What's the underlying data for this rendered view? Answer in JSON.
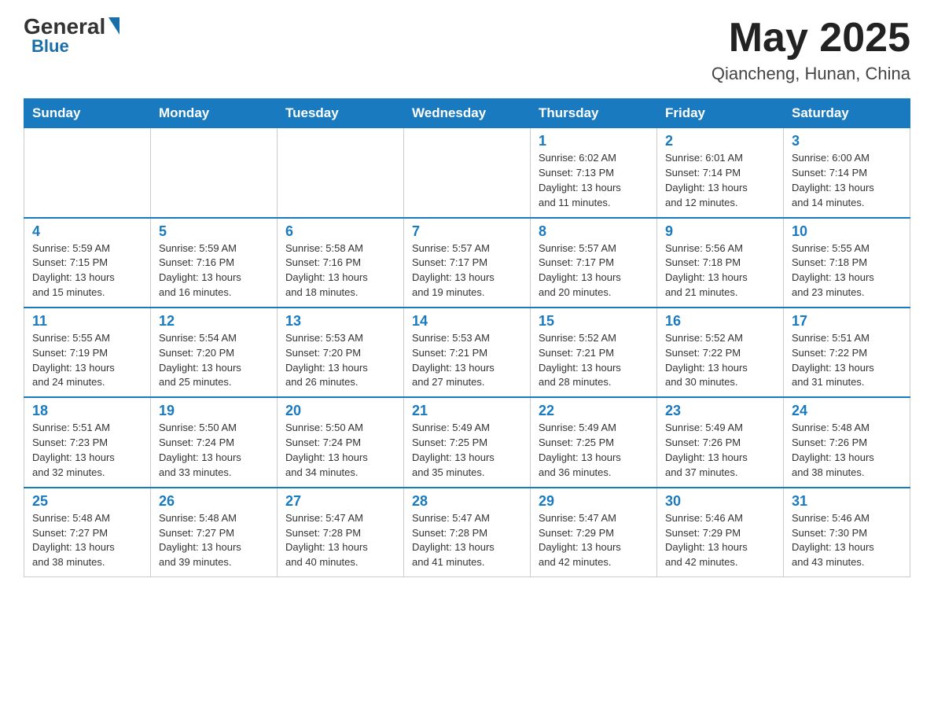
{
  "logo": {
    "general": "General",
    "blue": "Blue"
  },
  "title": {
    "month": "May 2025",
    "location": "Qiancheng, Hunan, China"
  },
  "weekdays": [
    "Sunday",
    "Monday",
    "Tuesday",
    "Wednesday",
    "Thursday",
    "Friday",
    "Saturday"
  ],
  "weeks": [
    [
      {
        "day": "",
        "info": ""
      },
      {
        "day": "",
        "info": ""
      },
      {
        "day": "",
        "info": ""
      },
      {
        "day": "",
        "info": ""
      },
      {
        "day": "1",
        "info": "Sunrise: 6:02 AM\nSunset: 7:13 PM\nDaylight: 13 hours\nand 11 minutes."
      },
      {
        "day": "2",
        "info": "Sunrise: 6:01 AM\nSunset: 7:14 PM\nDaylight: 13 hours\nand 12 minutes."
      },
      {
        "day": "3",
        "info": "Sunrise: 6:00 AM\nSunset: 7:14 PM\nDaylight: 13 hours\nand 14 minutes."
      }
    ],
    [
      {
        "day": "4",
        "info": "Sunrise: 5:59 AM\nSunset: 7:15 PM\nDaylight: 13 hours\nand 15 minutes."
      },
      {
        "day": "5",
        "info": "Sunrise: 5:59 AM\nSunset: 7:16 PM\nDaylight: 13 hours\nand 16 minutes."
      },
      {
        "day": "6",
        "info": "Sunrise: 5:58 AM\nSunset: 7:16 PM\nDaylight: 13 hours\nand 18 minutes."
      },
      {
        "day": "7",
        "info": "Sunrise: 5:57 AM\nSunset: 7:17 PM\nDaylight: 13 hours\nand 19 minutes."
      },
      {
        "day": "8",
        "info": "Sunrise: 5:57 AM\nSunset: 7:17 PM\nDaylight: 13 hours\nand 20 minutes."
      },
      {
        "day": "9",
        "info": "Sunrise: 5:56 AM\nSunset: 7:18 PM\nDaylight: 13 hours\nand 21 minutes."
      },
      {
        "day": "10",
        "info": "Sunrise: 5:55 AM\nSunset: 7:18 PM\nDaylight: 13 hours\nand 23 minutes."
      }
    ],
    [
      {
        "day": "11",
        "info": "Sunrise: 5:55 AM\nSunset: 7:19 PM\nDaylight: 13 hours\nand 24 minutes."
      },
      {
        "day": "12",
        "info": "Sunrise: 5:54 AM\nSunset: 7:20 PM\nDaylight: 13 hours\nand 25 minutes."
      },
      {
        "day": "13",
        "info": "Sunrise: 5:53 AM\nSunset: 7:20 PM\nDaylight: 13 hours\nand 26 minutes."
      },
      {
        "day": "14",
        "info": "Sunrise: 5:53 AM\nSunset: 7:21 PM\nDaylight: 13 hours\nand 27 minutes."
      },
      {
        "day": "15",
        "info": "Sunrise: 5:52 AM\nSunset: 7:21 PM\nDaylight: 13 hours\nand 28 minutes."
      },
      {
        "day": "16",
        "info": "Sunrise: 5:52 AM\nSunset: 7:22 PM\nDaylight: 13 hours\nand 30 minutes."
      },
      {
        "day": "17",
        "info": "Sunrise: 5:51 AM\nSunset: 7:22 PM\nDaylight: 13 hours\nand 31 minutes."
      }
    ],
    [
      {
        "day": "18",
        "info": "Sunrise: 5:51 AM\nSunset: 7:23 PM\nDaylight: 13 hours\nand 32 minutes."
      },
      {
        "day": "19",
        "info": "Sunrise: 5:50 AM\nSunset: 7:24 PM\nDaylight: 13 hours\nand 33 minutes."
      },
      {
        "day": "20",
        "info": "Sunrise: 5:50 AM\nSunset: 7:24 PM\nDaylight: 13 hours\nand 34 minutes."
      },
      {
        "day": "21",
        "info": "Sunrise: 5:49 AM\nSunset: 7:25 PM\nDaylight: 13 hours\nand 35 minutes."
      },
      {
        "day": "22",
        "info": "Sunrise: 5:49 AM\nSunset: 7:25 PM\nDaylight: 13 hours\nand 36 minutes."
      },
      {
        "day": "23",
        "info": "Sunrise: 5:49 AM\nSunset: 7:26 PM\nDaylight: 13 hours\nand 37 minutes."
      },
      {
        "day": "24",
        "info": "Sunrise: 5:48 AM\nSunset: 7:26 PM\nDaylight: 13 hours\nand 38 minutes."
      }
    ],
    [
      {
        "day": "25",
        "info": "Sunrise: 5:48 AM\nSunset: 7:27 PM\nDaylight: 13 hours\nand 38 minutes."
      },
      {
        "day": "26",
        "info": "Sunrise: 5:48 AM\nSunset: 7:27 PM\nDaylight: 13 hours\nand 39 minutes."
      },
      {
        "day": "27",
        "info": "Sunrise: 5:47 AM\nSunset: 7:28 PM\nDaylight: 13 hours\nand 40 minutes."
      },
      {
        "day": "28",
        "info": "Sunrise: 5:47 AM\nSunset: 7:28 PM\nDaylight: 13 hours\nand 41 minutes."
      },
      {
        "day": "29",
        "info": "Sunrise: 5:47 AM\nSunset: 7:29 PM\nDaylight: 13 hours\nand 42 minutes."
      },
      {
        "day": "30",
        "info": "Sunrise: 5:46 AM\nSunset: 7:29 PM\nDaylight: 13 hours\nand 42 minutes."
      },
      {
        "day": "31",
        "info": "Sunrise: 5:46 AM\nSunset: 7:30 PM\nDaylight: 13 hours\nand 43 minutes."
      }
    ]
  ]
}
